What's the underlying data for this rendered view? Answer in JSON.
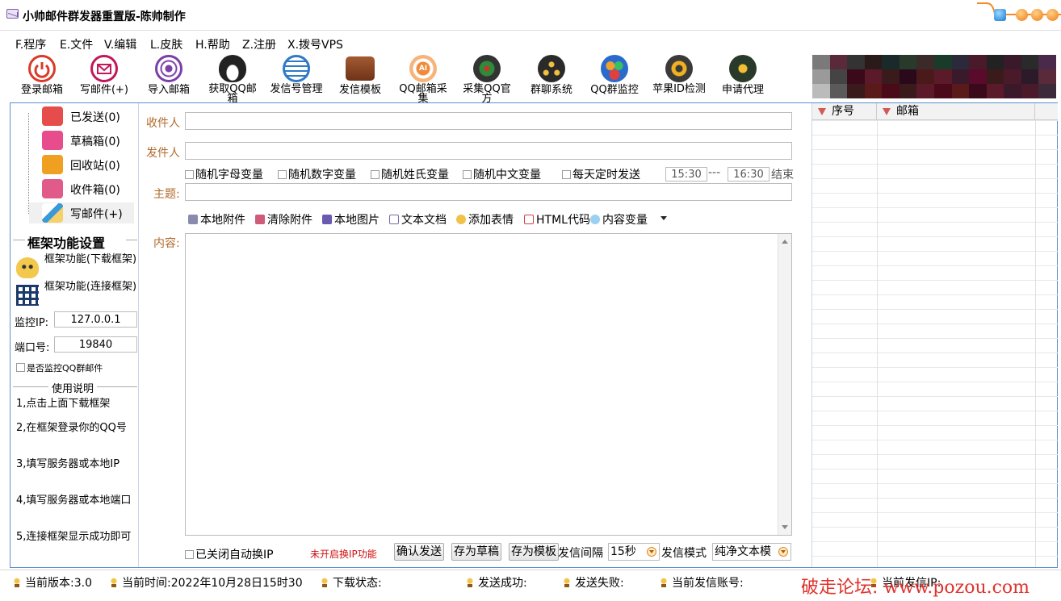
{
  "window": {
    "title": "小帅邮件群发器重置版-陈帅制作"
  },
  "menu": [
    "F.程序",
    "E.文件",
    "V.编辑",
    "L.皮肤",
    "H.帮助",
    "Z.注册",
    "X.拨号VPS"
  ],
  "toolbar": [
    {
      "label": "登录邮箱",
      "icon": "power-icon",
      "color": "#d93a2b"
    },
    {
      "label": "写邮件(+)",
      "icon": "envelope-icon",
      "color": "#c2185b"
    },
    {
      "label": "导入邮箱",
      "icon": "target-icon",
      "color": "#7b3fa8"
    },
    {
      "label": "获取QQ邮箱",
      "icon": "penguin-icon",
      "color": "#222222"
    },
    {
      "label": "发信号管理",
      "icon": "mail-stack-icon",
      "color": "#2f7ac6"
    },
    {
      "label": "发信模板",
      "icon": "wallet-icon",
      "color": "#8a4a2a"
    },
    {
      "label": "QQ邮箱采集",
      "icon": "ai-icon",
      "color": "#f08a3a"
    },
    {
      "label": "采集QQ官方",
      "icon": "globe-icon",
      "color": "#333333"
    },
    {
      "label": "群聊系统",
      "icon": "group-icon",
      "color": "#2a2a2a"
    },
    {
      "label": "QQ群监控",
      "icon": "people-icon",
      "color": "#2a6acc"
    },
    {
      "label": "苹果ID检测",
      "icon": "gear-icon",
      "color": "#3a3a3a"
    },
    {
      "label": "申请代理",
      "icon": "card-icon",
      "color": "#2a3a2a"
    }
  ],
  "folders": [
    {
      "label": "已发送(0)",
      "icon": "sent-icon",
      "color": "#e74c4c"
    },
    {
      "label": "草稿箱(0)",
      "icon": "draft-icon",
      "color": "#e74c8c"
    },
    {
      "label": "回收站(0)",
      "icon": "trash-icon",
      "color": "#f0a020"
    },
    {
      "label": "收件箱(0)",
      "icon": "inbox-icon",
      "color": "#e05a8a"
    },
    {
      "label": "写邮件(+)",
      "icon": "compose-icon",
      "color": "#3a9ad9"
    }
  ],
  "left": {
    "section_title": "框架功能设置",
    "frame_download": "框架功能(下载框架)",
    "frame_connect": "框架功能(连接框架)",
    "ip_label": "监控IP:",
    "ip_value": "127.0.0.1",
    "port_label": "端口号:",
    "port_value": "19840",
    "monitor_check": "是否监控QQ群邮件",
    "usage_title": "使用说明",
    "usage": [
      "1,点击上面下载框架",
      "2,在框架登录你的QQ号",
      "3,填写服务器或本地IP",
      "4,填写服务器或本地端口",
      "5,连接框架显示成功即可"
    ]
  },
  "compose": {
    "to_label": "收件人",
    "from_label": "发件人",
    "subject_label": "主题:",
    "content_label": "内容:",
    "options": [
      "随机字母变量",
      "随机数字变量",
      "随机姓氏变量",
      "随机中文变量",
      "每天定时发送"
    ],
    "time_start": "15:30",
    "time_sep": "---",
    "time_end": "16:30",
    "time_end_label": "结束",
    "attach": [
      {
        "label": "本地附件",
        "icon": "paperclip-icon"
      },
      {
        "label": "清除附件",
        "icon": "eraser-icon"
      },
      {
        "label": "本地图片",
        "icon": "image-icon"
      },
      {
        "label": "文本文档",
        "icon": "document-icon"
      },
      {
        "label": "添加表情",
        "icon": "emoji-icon"
      },
      {
        "label": "HTML代码",
        "icon": "html-icon"
      },
      {
        "label": "内容变量",
        "icon": "variable-icon"
      }
    ]
  },
  "bottom": {
    "auto_ip": "已关闭自动换IP",
    "ip_status": "未开启换IP功能",
    "confirm_send": "确认发送",
    "save_draft": "存为草稿",
    "save_template": "存为模板",
    "interval_label": "发信间隔",
    "interval_value": "15秒",
    "mode_label": "发信模式",
    "mode_value": "纯净文本模"
  },
  "grid": {
    "columns": [
      "序号",
      "邮箱"
    ]
  },
  "status": {
    "version": "当前版本:3.0",
    "time": "当前时间:2022年10月28日15时30",
    "download": "下载状态:",
    "success": "发送成功:",
    "failed": "发送失败:",
    "account": "当前发信账号:",
    "ip": "当前发信IP:"
  },
  "watermark": "破走论坛: www.pozou.com",
  "colors": {
    "frame_border": "#5b8fd1",
    "label_orange": "#b06a2a",
    "warn_red": "#d01010"
  }
}
